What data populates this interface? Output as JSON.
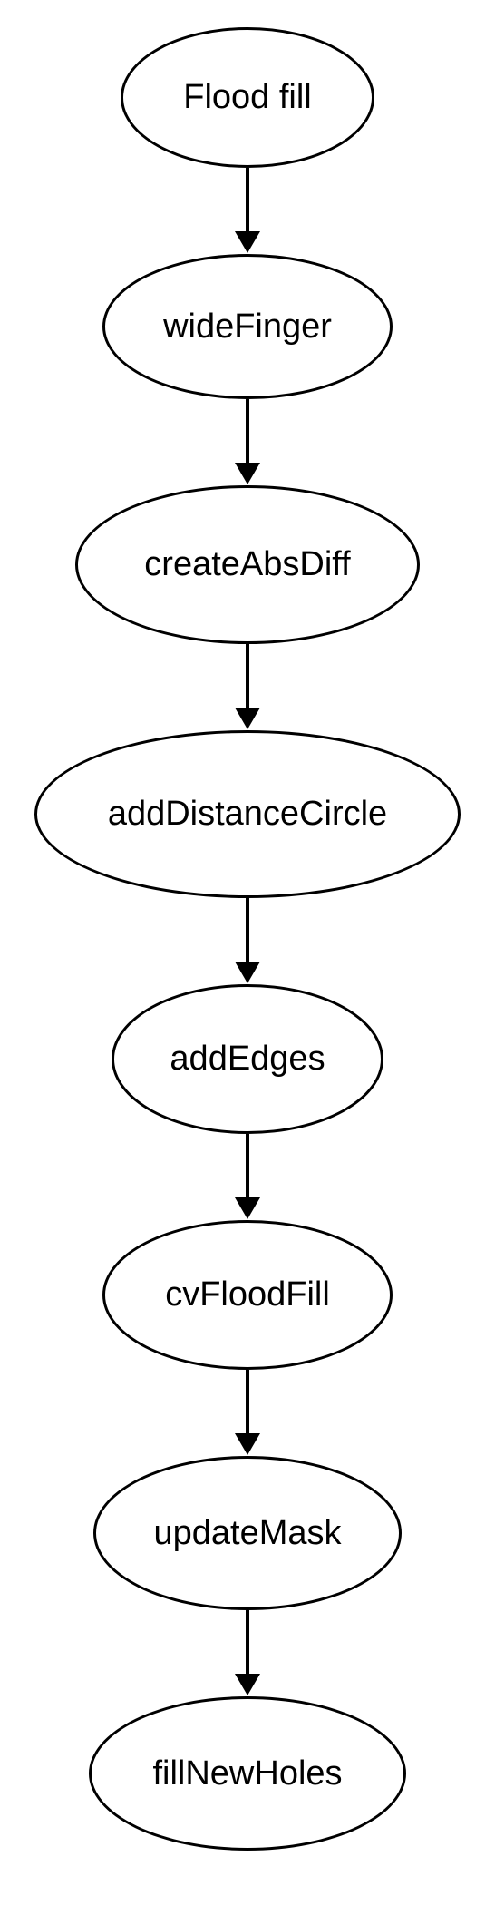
{
  "diagram": {
    "type": "flowchart",
    "direction": "vertical",
    "nodes": [
      {
        "label": "Flood fill",
        "shape": "ellipse"
      },
      {
        "label": "wideFinger",
        "shape": "ellipse"
      },
      {
        "label": "createAbsDiff",
        "shape": "ellipse"
      },
      {
        "label": "addDistanceCircle",
        "shape": "ellipse"
      },
      {
        "label": "addEdges",
        "shape": "ellipse"
      },
      {
        "label": "cvFloodFill",
        "shape": "ellipse"
      },
      {
        "label": "updateMask",
        "shape": "ellipse"
      },
      {
        "label": "fillNewHoles",
        "shape": "ellipse"
      }
    ],
    "edges": [
      {
        "from": 0,
        "to": 1
      },
      {
        "from": 1,
        "to": 2
      },
      {
        "from": 2,
        "to": 3
      },
      {
        "from": 3,
        "to": 4
      },
      {
        "from": 4,
        "to": 5
      },
      {
        "from": 5,
        "to": 6
      },
      {
        "from": 6,
        "to": 7
      }
    ]
  }
}
